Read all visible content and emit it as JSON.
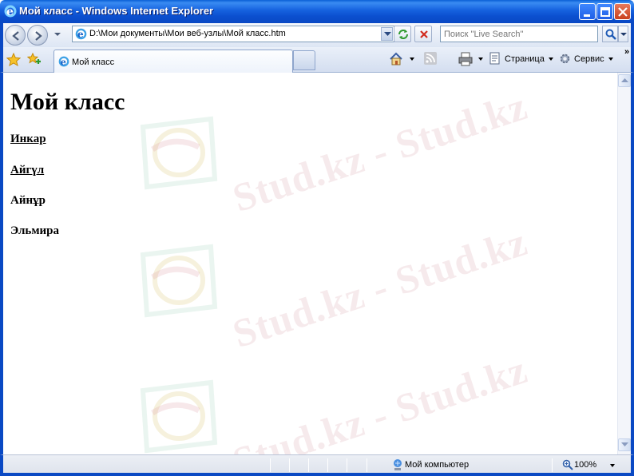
{
  "window": {
    "title": "Мой класс - Windows Internet Explorer"
  },
  "address": {
    "url": "D:\\Мои документы\\Мои веб-узлы\\Мой класс.htm"
  },
  "search": {
    "placeholder": "Поиск \"Live Search\""
  },
  "tabs": [
    {
      "label": "Мой класс"
    }
  ],
  "command_bar": {
    "page_label": "Страница",
    "tools_label": "Сервис",
    "more_label": "»"
  },
  "page": {
    "heading": "Мой класс",
    "names": [
      {
        "text": "Инкар",
        "link": true
      },
      {
        "text": "Айгүл",
        "link": true
      },
      {
        "text": "Айнұр",
        "link": false
      },
      {
        "text": "Эльмира",
        "link": false
      }
    ],
    "watermark_text": "Stud.kz - Stud.kz"
  },
  "status": {
    "zone": "Мой компьютер",
    "zoom": "100%"
  },
  "colors": {
    "title_bar": "#0a5fd6",
    "frame": "#0a49c4",
    "close_button": "#c9401d"
  }
}
